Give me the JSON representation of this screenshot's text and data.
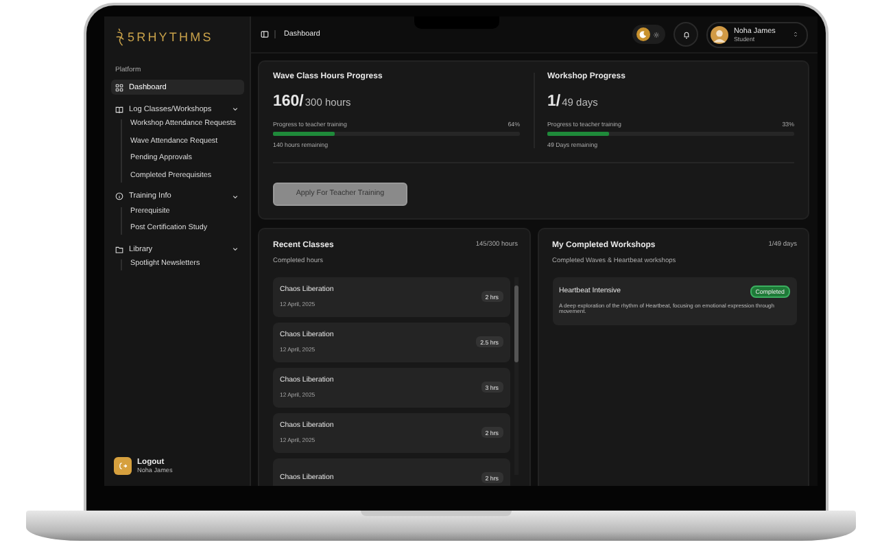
{
  "brand": {
    "name": "5RHYTHMS"
  },
  "sidebar": {
    "section": "Platform",
    "items": [
      {
        "label": "Dashboard",
        "selected": true
      },
      {
        "label": "Log Classes/Workshops",
        "selected": false,
        "expanded": true,
        "children": [
          {
            "label": "Workshop Attendance Requests",
            "selected": false
          },
          {
            "label": "Wave Attendance Request",
            "selected": false
          },
          {
            "label": "Pending Approvals",
            "selected": false
          },
          {
            "label": "Completed Prerequisites",
            "selected": false
          }
        ]
      },
      {
        "label": "Training Info",
        "selected": false,
        "expanded": true,
        "children": [
          {
            "label": "Prerequisite",
            "selected": false
          },
          {
            "label": "Post Certification Study",
            "selected": false
          }
        ]
      },
      {
        "label": "Library",
        "selected": false,
        "expanded": true,
        "children": [
          {
            "label": "Spotlight Newsletters",
            "selected": false
          }
        ]
      }
    ],
    "footer": {
      "label": "Logout",
      "name": "Noha James"
    }
  },
  "topbar": {
    "breadcrumb": "Dashboard",
    "light_mode": false,
    "user": {
      "name": "Noha James",
      "role": "Student"
    }
  },
  "progress": [
    {
      "title": "Wave Class Hours Progress",
      "value": "160/",
      "unit": "300 hours",
      "label": "Progress to teacher training",
      "percent": "64%",
      "level": 0.25,
      "remaining": "140 hours remaining"
    },
    {
      "title": "Workshop Progress",
      "value": "1/",
      "unit": "49 days",
      "label": "Progress to teacher training",
      "percent": "33%",
      "level": 0.25,
      "remaining": "49 Days remaining"
    }
  ],
  "apply_button": {
    "label": "Apply For Teacher Training",
    "disabled": true
  },
  "recent_classes": {
    "title": "Recent Classes",
    "count": "145/300 hours",
    "subtitle": "Completed hours",
    "items": [
      {
        "name": "Chaos Liberation",
        "date": "12 April, 2025",
        "hours": "2 hrs"
      },
      {
        "name": "Chaos Liberation",
        "date": "12 April, 2025",
        "hours": "2.5 hrs"
      },
      {
        "name": "Chaos Liberation",
        "date": "12 April, 2025",
        "hours": "3 hrs"
      },
      {
        "name": "Chaos Liberation",
        "date": "12 April, 2025",
        "hours": "2 hrs"
      },
      {
        "name": "Chaos Liberation",
        "hours": "2 hrs"
      }
    ]
  },
  "workshops": {
    "title": "My Completed Workshops",
    "count": "1/49 days",
    "subtitle": "Completed Waves & Heartbeat workshops",
    "items": [
      {
        "name": "Heartbeat Intensive",
        "status": "Completed",
        "completed": true,
        "description": "A deep exploration of the rhythm of Heartbeat, focusing on emotional expression through movement."
      }
    ]
  }
}
